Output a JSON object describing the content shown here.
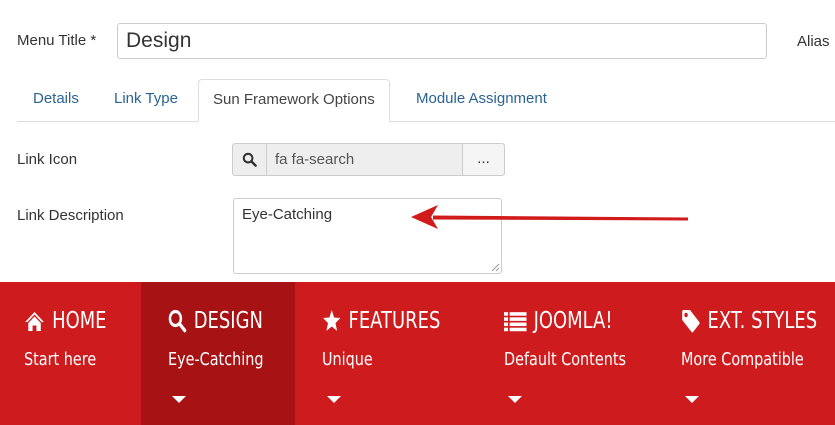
{
  "form": {
    "menu_title_label": "Menu Title *",
    "menu_title_value": "Design",
    "alias_label": "Alias"
  },
  "tabs": [
    {
      "label": "Details",
      "active": false
    },
    {
      "label": "Link Type",
      "active": false
    },
    {
      "label": "Sun Framework Options",
      "active": true
    },
    {
      "label": "Module Assignment",
      "active": false
    }
  ],
  "fields": {
    "link_icon_label": "Link Icon",
    "link_icon_value": "fa fa-search",
    "link_icon_button": "...",
    "link_description_label": "Link Description",
    "link_description_value": "Eye-Catching"
  },
  "menu": {
    "items": [
      {
        "title": "HOME",
        "subtitle": "Start here",
        "icon": "home-icon",
        "active": false
      },
      {
        "title": "DESIGN",
        "subtitle": "Eye-Catching",
        "icon": "search-icon",
        "active": true
      },
      {
        "title": "FEATURES",
        "subtitle": "Unique",
        "icon": "star-icon",
        "active": false
      },
      {
        "title": "JOOMLA!",
        "subtitle": "Default Contents",
        "icon": "list-icon",
        "active": false
      },
      {
        "title": "EXT. STYLES",
        "subtitle": "More Compatible",
        "icon": "tag-icon",
        "active": false
      }
    ]
  },
  "colors": {
    "menu_bg": "#ce1b1d",
    "menu_active_bg": "#a71314",
    "link_color": "#2a6496",
    "arrow_color": "#d11a1a"
  }
}
